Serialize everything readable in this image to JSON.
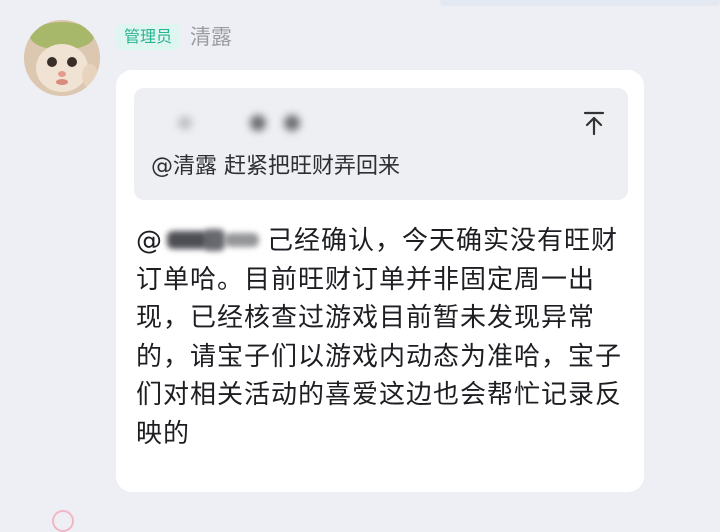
{
  "sender": {
    "role_badge": "管理员",
    "name": "清露"
  },
  "quoted": {
    "text": "@清露 赶紧把旺财弄回来"
  },
  "message": {
    "mention_prefix": "@",
    "body": "己经确认，今天确实没有旺财订单哈。目前旺财订单并非固定周一出现，已经核查过游戏目前暂未发现异常的，请宝子们以游戏内动态为准哈，宝子们对相关活动的喜爱这边也会帮忙记录反映的"
  },
  "colors": {
    "background": "#eeeff4",
    "bubble": "#ffffff",
    "quote_bg": "#eeeff2",
    "badge_bg": "#dff5ef",
    "badge_text": "#29b392"
  },
  "icons": {
    "pin": "arrow-up-to-top-icon"
  }
}
